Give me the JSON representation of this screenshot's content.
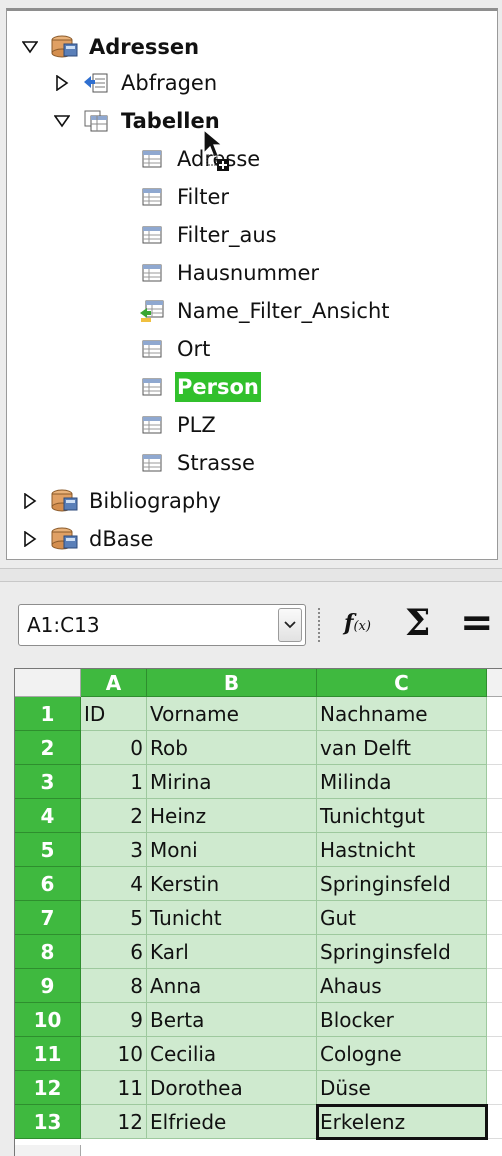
{
  "navigator": {
    "root": {
      "label": "Adressen",
      "expanded": true
    },
    "queries": {
      "label": "Abfragen",
      "expanded": false
    },
    "tables": {
      "label": "Tabellen",
      "expanded": true
    },
    "table_items": [
      {
        "label": "Adresse",
        "icon": "table-icon",
        "selected": false
      },
      {
        "label": "Filter",
        "icon": "table-icon",
        "selected": false
      },
      {
        "label": "Filter_aus",
        "icon": "table-icon",
        "selected": false
      },
      {
        "label": "Hausnummer",
        "icon": "table-icon",
        "selected": false
      },
      {
        "label": "Name_Filter_Ansicht",
        "icon": "view-icon",
        "selected": false
      },
      {
        "label": "Ort",
        "icon": "table-icon",
        "selected": false
      },
      {
        "label": "Person",
        "icon": "table-icon",
        "selected": true
      },
      {
        "label": "PLZ",
        "icon": "table-icon",
        "selected": false
      },
      {
        "label": "Strasse",
        "icon": "table-icon",
        "selected": false
      }
    ],
    "other_sources": [
      {
        "label": "Bibliography",
        "expanded": false
      },
      {
        "label": "dBase",
        "expanded": false
      }
    ],
    "selection_color": "#31c02c"
  },
  "formula_bar": {
    "name_box": "A1:C13",
    "function_wizard_icon": "function-wizard-icon",
    "sum_icon": "sum-icon",
    "equals_icon": "equals-icon"
  },
  "sheet": {
    "columns": [
      "A",
      "B",
      "C"
    ],
    "header_color": "#3fb93f",
    "selection_fill": "#cfeacf",
    "rows": [
      {
        "row": "1",
        "a": "ID",
        "b": "Vorname",
        "c": "Nachname"
      },
      {
        "row": "2",
        "a": "0",
        "b": "Rob",
        "c": "van Delft"
      },
      {
        "row": "3",
        "a": "1",
        "b": "Mirina",
        "c": "Milinda"
      },
      {
        "row": "4",
        "a": "2",
        "b": "Heinz",
        "c": "Tunichtgut"
      },
      {
        "row": "5",
        "a": "3",
        "b": "Moni",
        "c": "Hastnicht"
      },
      {
        "row": "6",
        "a": "4",
        "b": "Kerstin",
        "c": "Springinsfeld"
      },
      {
        "row": "7",
        "a": "5",
        "b": "Tunicht",
        "c": "Gut"
      },
      {
        "row": "8",
        "a": "6",
        "b": "Karl",
        "c": "Springinsfeld"
      },
      {
        "row": "9",
        "a": "8",
        "b": "Anna",
        "c": "Ahaus"
      },
      {
        "row": "10",
        "a": "9",
        "b": "Berta",
        "c": "Blocker"
      },
      {
        "row": "11",
        "a": "10",
        "b": "Cecilia",
        "c": "Cologne"
      },
      {
        "row": "12",
        "a": "11",
        "b": "Dorothea",
        "c": "Düse"
      },
      {
        "row": "13",
        "a": "12",
        "b": "Elfriede",
        "c": "Erkelenz"
      }
    ]
  }
}
